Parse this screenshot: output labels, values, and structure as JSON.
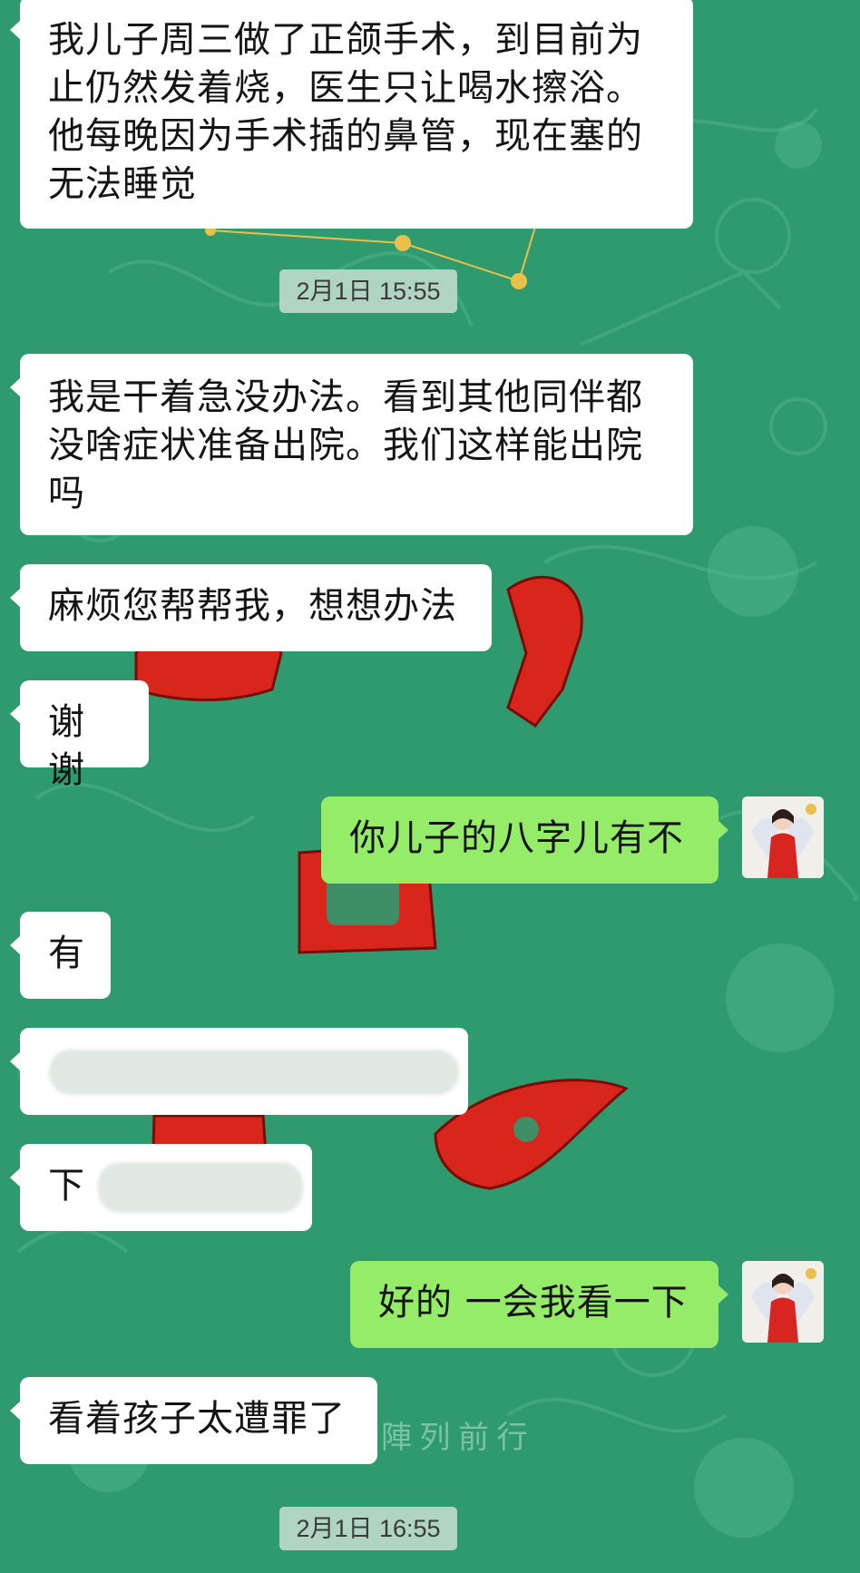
{
  "messages": [
    {
      "side": "in",
      "text": "我儿子周三做了正颌手术，到目前为\n止仍然发着烧，医生只让喝水擦浴。\n他每晚因为手术插的鼻管，现在塞的\n无法睡觉"
    },
    {
      "side": "in",
      "text": "我是干着急没办法。看到其他同伴都\n没啥症状准备出院。我们这样能出院\n吗"
    },
    {
      "side": "in",
      "text": "麻烦您帮帮我，想想办法"
    },
    {
      "side": "in",
      "text": "谢谢"
    },
    {
      "side": "out",
      "text": "你儿子的八字儿有不"
    },
    {
      "side": "in",
      "text": "有"
    },
    {
      "side": "in",
      "text": "",
      "redacted": true
    },
    {
      "side": "in",
      "text": "下",
      "redacted": true
    },
    {
      "side": "out",
      "text": "好的 一会我看一下"
    },
    {
      "side": "in",
      "text": "看着孩子太遭罪了"
    }
  ],
  "timestamps": [
    "2月1日 15:55",
    "2月1日 16:55"
  ],
  "background": {
    "caption": "陣 列 前 行",
    "color": "#2f9a6e"
  },
  "colors": {
    "incoming_bubble": "#ffffff",
    "outgoing_bubble": "#95ec69",
    "background": "#2f9a6e"
  },
  "icons": {
    "avatar": "user-avatar-icon"
  }
}
